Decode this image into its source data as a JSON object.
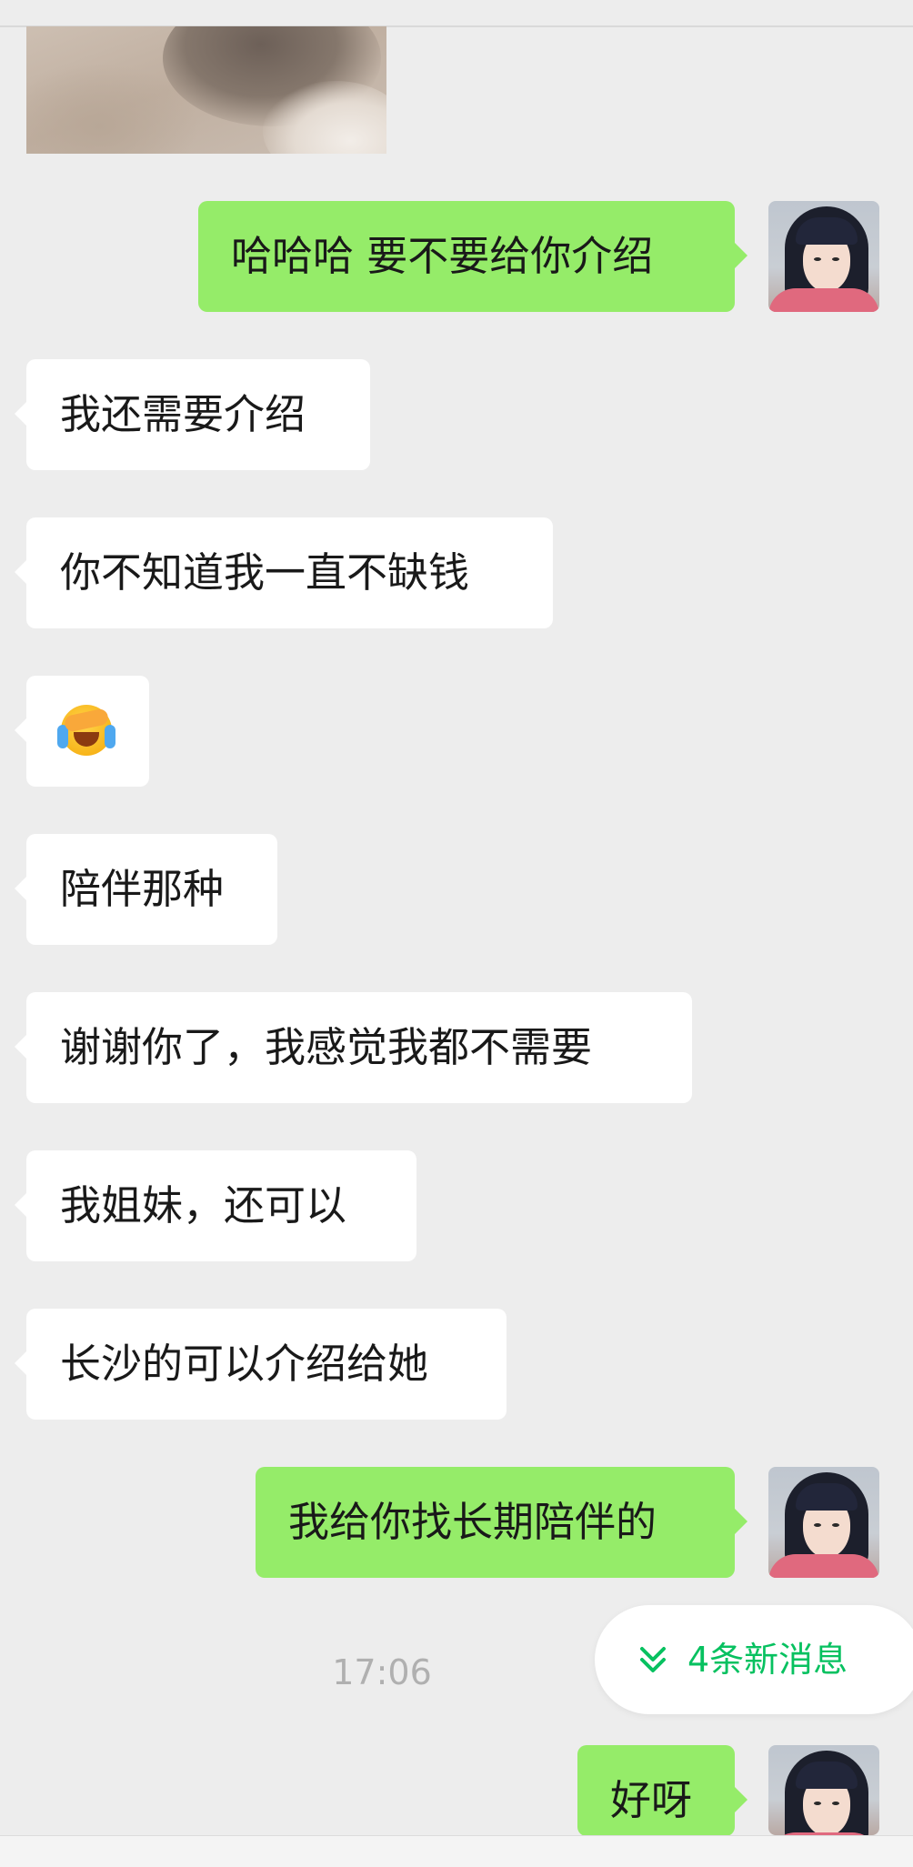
{
  "colors": {
    "background": "#ededed",
    "incoming_bubble": "#ffffff",
    "outgoing_bubble": "#95ec69",
    "accent": "#07c160",
    "timestamp": "#b0b0b0"
  },
  "messages": [
    {
      "side": "out",
      "text": "哈哈哈 要不要给你介绍"
    },
    {
      "side": "in",
      "text": "我还需要介绍"
    },
    {
      "side": "in",
      "text": "你不知道我一直不缺钱"
    },
    {
      "side": "in",
      "icon": "face-with-tears-emoji"
    },
    {
      "side": "in",
      "text": "陪伴那种"
    },
    {
      "side": "in",
      "text": "谢谢你了，我感觉我都不需要"
    },
    {
      "side": "in",
      "text": "我姐妹，还可以"
    },
    {
      "side": "in",
      "text": "长沙的可以介绍给她"
    },
    {
      "side": "out",
      "text": "我给你找长期陪伴的"
    },
    {
      "side": "out",
      "text": "好呀"
    }
  ],
  "timestamp": "17:06",
  "new_messages": {
    "label": "4条新消息",
    "icon": "double-chevron-down-icon"
  }
}
